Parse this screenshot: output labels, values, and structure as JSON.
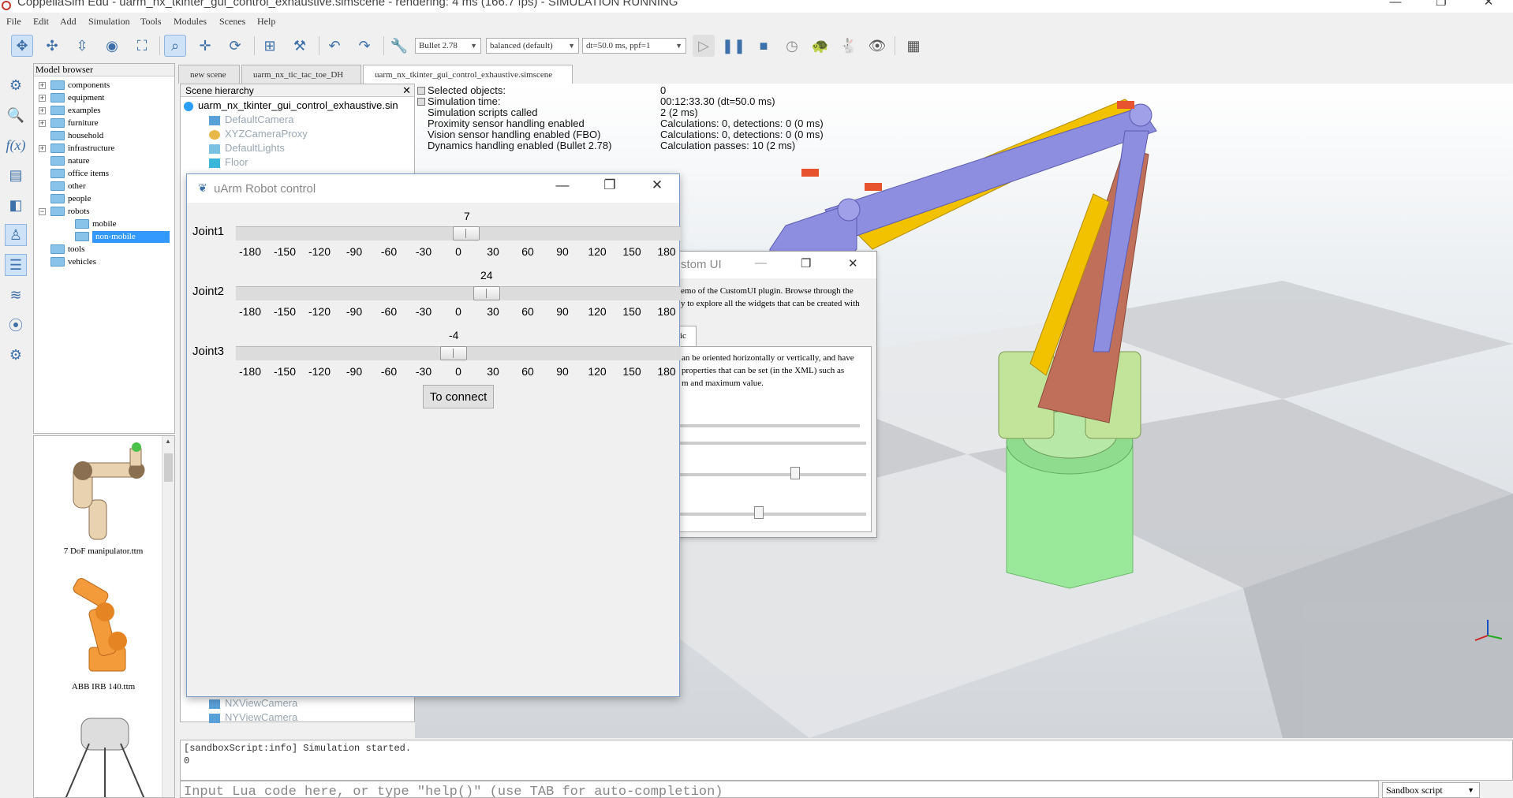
{
  "window": {
    "title": "CoppeliaSim Edu - uarm_nx_tkinter_gui_control_exhaustive.simscene - rendering: 4 ms (166.7 fps) - SIMULATION RUNNING",
    "minimize": "—",
    "maximize": "❐",
    "close": "✕"
  },
  "menu": [
    "File",
    "Edit",
    "Add",
    "Simulation",
    "Tools",
    "Modules",
    "Scenes",
    "Help"
  ],
  "toolbar": {
    "engine": "Bullet 2.78",
    "mode": "balanced (default)",
    "dt": "dt=50.0 ms, ppf=1"
  },
  "model_browser": {
    "title": "Model browser",
    "items": [
      {
        "label": "components",
        "expand": "+"
      },
      {
        "label": "equipment",
        "expand": "+"
      },
      {
        "label": "examples",
        "expand": "+"
      },
      {
        "label": "furniture",
        "expand": "+"
      },
      {
        "label": "household",
        "expand": ""
      },
      {
        "label": "infrastructure",
        "expand": "+"
      },
      {
        "label": "nature",
        "expand": ""
      },
      {
        "label": "office items",
        "expand": ""
      },
      {
        "label": "other",
        "expand": ""
      },
      {
        "label": "people",
        "expand": ""
      },
      {
        "label": "robots",
        "expand": "−"
      },
      {
        "label": "mobile",
        "expand": ""
      },
      {
        "label": "non-mobile",
        "expand": ""
      },
      {
        "label": "tools",
        "expand": ""
      },
      {
        "label": "vehicles",
        "expand": ""
      }
    ],
    "thumbnails": [
      "7 DoF manipulator.ttm",
      "ABB IRB 140.ttm"
    ]
  },
  "tabs": [
    "new scene",
    "uarm_nx_tic_tac_toe_DH",
    "uarm_nx_tkinter_gui_control_exhaustive.simscene"
  ],
  "scene_hierarchy": {
    "title": "Scene hierarchy",
    "close": "✕",
    "root": "uarm_nx_tkinter_gui_control_exhaustive.sin",
    "items": [
      "DefaultCamera",
      "XYZCameraProxy",
      "DefaultLights",
      "Floor"
    ],
    "bottom_items": [
      "NXViewCamera",
      "NYViewCamera"
    ]
  },
  "info": {
    "labels": [
      "Selected objects:",
      "Simulation time:",
      "Simulation scripts called",
      "Proximity sensor handling enabled",
      "Vision sensor handling enabled (FBO)",
      "Dynamics handling enabled (Bullet 2.78)"
    ],
    "values": [
      "0",
      "00:12:33.30 (dt=50.0 ms)",
      "2 (2 ms)",
      "Calculations: 0, detections: 0 (0 ms)",
      "Calculations: 0, detections: 0 (0 ms)",
      "Calculation passes: 10 (2 ms)"
    ]
  },
  "customui": {
    "title": "stom UI",
    "text1_line1": "emo of the CustomUI plugin. Browse through the",
    "text1_line2": "y to explore all the widgets that can be created with",
    "tab": "ic",
    "text2_line1": "an be oriented horizontally or vertically, and have",
    "text2_line2": "properties that can be set (in the XML) such as",
    "text2_line3": "m and maximum value."
  },
  "uarm": {
    "title": "uArm Robot control",
    "joints": [
      {
        "label": "Joint1",
        "value": "7",
        "fraction": 0.519
      },
      {
        "label": "Joint2",
        "value": "24",
        "fraction": 0.567
      },
      {
        "label": "Joint3",
        "value": "-4",
        "fraction": 0.489
      }
    ],
    "ticks": [
      "-180",
      "-150",
      "-120",
      "-90",
      "-60",
      "-30",
      "0",
      "30",
      "60",
      "90",
      "120",
      "150",
      "180"
    ],
    "connect_label": "To connect"
  },
  "console": {
    "lines": [
      "[sandboxScript:info] Simulation started.",
      "0"
    ],
    "placeholder": "Input Lua code here, or type \"help()\" (use TAB for auto-completion)",
    "script_selector": "Sandbox script"
  },
  "colors": {
    "accent": "#3399ff",
    "robot_base": "#9ae89a",
    "robot_arm_yellow": "#f2c200",
    "robot_link_red": "#c0705a",
    "robot_purple": "#8e8ee0"
  }
}
